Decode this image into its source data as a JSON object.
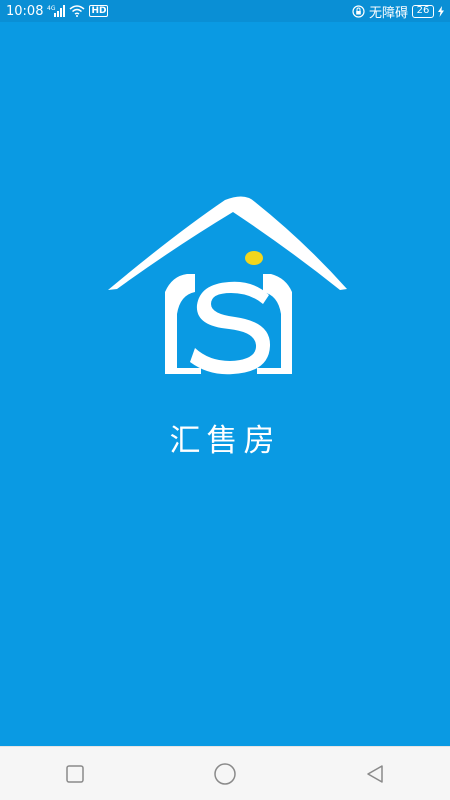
{
  "status_bar": {
    "time": "10:08",
    "network": "4G",
    "hd_label": "HD",
    "accessibility_label": "无障碍",
    "battery_level": "26"
  },
  "splash": {
    "app_name": "汇售房",
    "background_color": "#0a9ae3",
    "logo_accent_color": "#f2d61d"
  },
  "nav_bar": {
    "icons": [
      "square-recent-icon",
      "circle-home-icon",
      "triangle-back-icon"
    ]
  }
}
